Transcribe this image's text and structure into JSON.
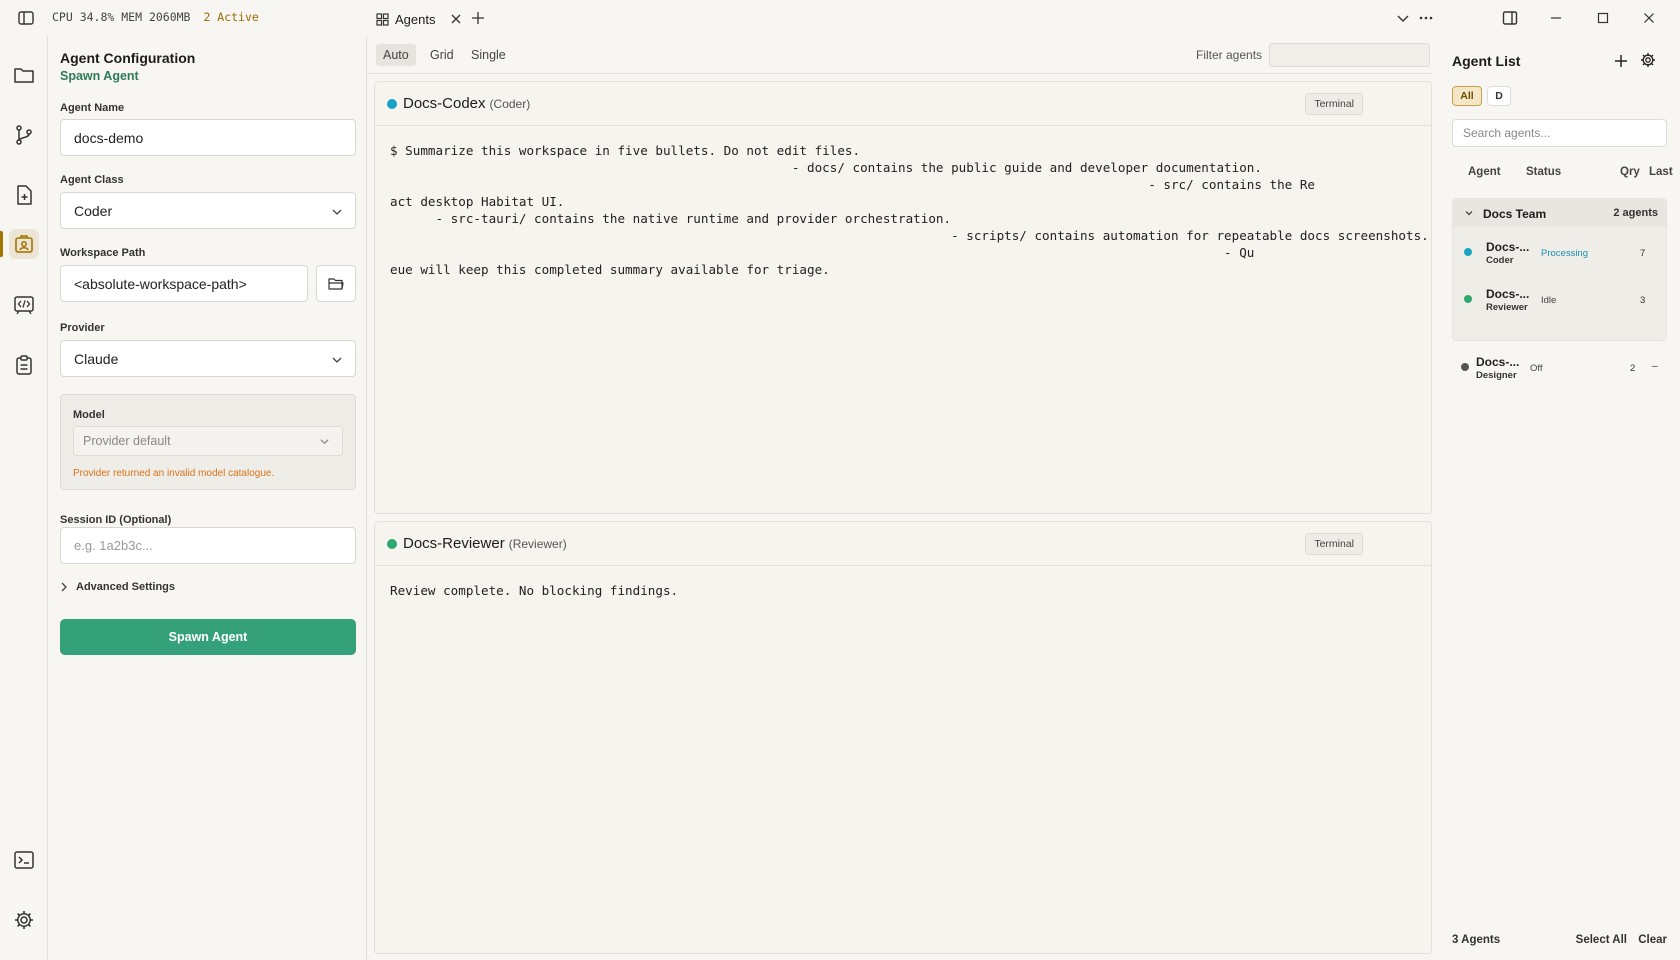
{
  "titlebar": {
    "cpu": "CPU 34.8%",
    "mem": "MEM 2060MB",
    "active": "2 Active",
    "tab_label": "Agents"
  },
  "config": {
    "title": "Agent Configuration",
    "subtitle": "Spawn Agent",
    "agent_name_label": "Agent Name",
    "agent_name_value": "docs-demo",
    "agent_class_label": "Agent Class",
    "agent_class_value": "Coder",
    "workspace_label": "Workspace Path",
    "workspace_value": "<absolute-workspace-path>",
    "provider_label": "Provider",
    "provider_value": "Claude",
    "model_label": "Model",
    "model_value": "Provider default",
    "model_error": "Provider returned an invalid model catalogue.",
    "session_label": "Session ID (Optional)",
    "session_placeholder": "e.g. 1a2b3c...",
    "advanced_label": "Advanced Settings",
    "spawn_label": "Spawn Agent"
  },
  "viewbar": {
    "modes": [
      "Auto",
      "Grid",
      "Single"
    ],
    "filter_label": "Filter agents"
  },
  "panes": [
    {
      "name": "Docs-Codex",
      "class": "(Coder)",
      "terminal_label": "Terminal",
      "dot_color": "#1aa3c4",
      "output": "$ Summarize this workspace in five bullets. Do not edit files.\n                                                     - docs/ contains the public guide and developer documentation.\n                                                                                                    - src/ contains the Re\nact desktop Habitat UI.\n      - src-tauri/ contains the native runtime and provider orchestration.\n                                                                          - scripts/ contains automation for repeatable docs screenshots.\n                                                                                                              - Qu\neue will keep this completed summary available for triage."
    },
    {
      "name": "Docs-Reviewer",
      "class": "(Reviewer)",
      "terminal_label": "Terminal",
      "dot_color": "#2eaa6e",
      "output": "Review complete. No blocking findings."
    }
  ],
  "agent_list": {
    "title": "Agent List",
    "chip_all": "All",
    "chip_d": "D",
    "search_placeholder": "Search agents...",
    "columns": [
      "Agent",
      "Status",
      "Qry",
      "Last"
    ],
    "group": {
      "name": "Docs Team",
      "count": "2 agents"
    },
    "agents": [
      {
        "name": "Docs-...",
        "class": "Coder",
        "status": "Processing",
        "status_color": "#1a8fb0",
        "qry": "7",
        "last": "",
        "dot": "#1aa3c4"
      },
      {
        "name": "Docs-...",
        "class": "Reviewer",
        "status": "Idle",
        "status_color": "#444444",
        "qry": "3",
        "last": "",
        "dot": "#2eaa6e"
      },
      {
        "name": "Docs-...",
        "class": "Designer",
        "status": "Off",
        "status_color": "#444444",
        "qry": "2",
        "last": "–",
        "dot": "#555555"
      }
    ],
    "footer_count": "3 Agents",
    "select_all": "Select All",
    "clear": "Clear"
  }
}
